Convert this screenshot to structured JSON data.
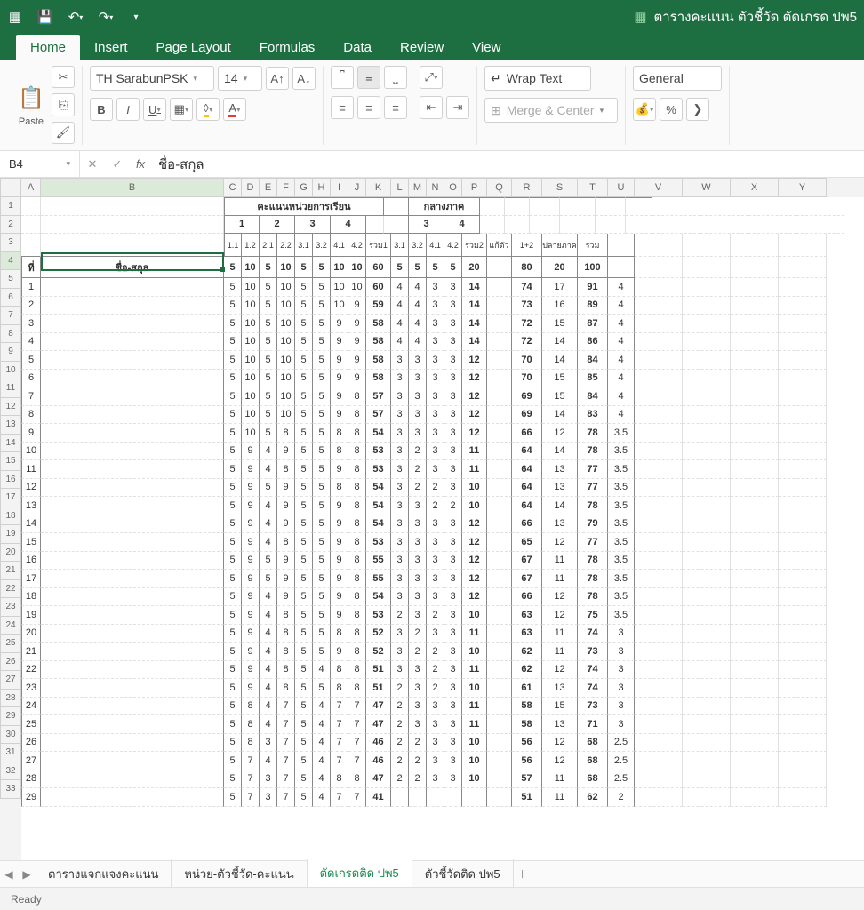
{
  "title": "ตารางคะแนน ตัวชี้วัด ตัดเกรด ปพ5",
  "tabs": [
    "Home",
    "Insert",
    "Page Layout",
    "Formulas",
    "Data",
    "Review",
    "View"
  ],
  "activeTab": "Home",
  "ribbon": {
    "paste": "Paste",
    "font": "TH SarabunPSK",
    "fontSize": "14",
    "wrap": "Wrap Text",
    "merge": "Merge & Center",
    "numberFormat": "General"
  },
  "nameBox": "B4",
  "formula": "ชื่อ-สกุล",
  "colHeaders": [
    "A",
    "B",
    "C",
    "D",
    "E",
    "F",
    "G",
    "H",
    "I",
    "J",
    "K",
    "L",
    "M",
    "N",
    "O",
    "P",
    "Q",
    "R",
    "S",
    "T",
    "U",
    "V",
    "W",
    "X",
    "Y"
  ],
  "rowCount": 33,
  "gridHeader": {
    "top1_unit": "คะแนนหน่วยการเรียน",
    "top1_mid": "กลางภาค",
    "units": [
      "1",
      "2",
      "3",
      "4"
    ],
    "midUnits": [
      "3",
      "4"
    ],
    "sub": [
      "1.1",
      "1.2",
      "2.1",
      "2.2",
      "3.1",
      "3.2",
      "4.1",
      "4.2",
      "รวม1",
      "3.1",
      "3.2",
      "4.1",
      "4.2",
      "รวม2",
      "แก้ตัว",
      "1+2",
      "ปลายภาค",
      "รวม"
    ],
    "colA4": "ที่",
    "colB4": "ชื่อ-สกุล",
    "max": [
      "5",
      "10",
      "5",
      "10",
      "5",
      "5",
      "10",
      "10",
      "60",
      "5",
      "5",
      "5",
      "5",
      "20",
      "",
      "80",
      "20",
      "100",
      ""
    ]
  },
  "rows": [
    [
      "1",
      "5",
      "10",
      "5",
      "10",
      "5",
      "5",
      "10",
      "10",
      "60",
      "4",
      "4",
      "3",
      "3",
      "14",
      "",
      "74",
      "17",
      "91",
      "4"
    ],
    [
      "2",
      "5",
      "10",
      "5",
      "10",
      "5",
      "5",
      "10",
      "9",
      "59",
      "4",
      "4",
      "3",
      "3",
      "14",
      "",
      "73",
      "16",
      "89",
      "4"
    ],
    [
      "3",
      "5",
      "10",
      "5",
      "10",
      "5",
      "5",
      "9",
      "9",
      "58",
      "4",
      "4",
      "3",
      "3",
      "14",
      "",
      "72",
      "15",
      "87",
      "4"
    ],
    [
      "4",
      "5",
      "10",
      "5",
      "10",
      "5",
      "5",
      "9",
      "9",
      "58",
      "4",
      "4",
      "3",
      "3",
      "14",
      "",
      "72",
      "14",
      "86",
      "4"
    ],
    [
      "5",
      "5",
      "10",
      "5",
      "10",
      "5",
      "5",
      "9",
      "9",
      "58",
      "3",
      "3",
      "3",
      "3",
      "12",
      "",
      "70",
      "14",
      "84",
      "4"
    ],
    [
      "6",
      "5",
      "10",
      "5",
      "10",
      "5",
      "5",
      "9",
      "9",
      "58",
      "3",
      "3",
      "3",
      "3",
      "12",
      "",
      "70",
      "15",
      "85",
      "4"
    ],
    [
      "7",
      "5",
      "10",
      "5",
      "10",
      "5",
      "5",
      "9",
      "8",
      "57",
      "3",
      "3",
      "3",
      "3",
      "12",
      "",
      "69",
      "15",
      "84",
      "4"
    ],
    [
      "8",
      "5",
      "10",
      "5",
      "10",
      "5",
      "5",
      "9",
      "8",
      "57",
      "3",
      "3",
      "3",
      "3",
      "12",
      "",
      "69",
      "14",
      "83",
      "4"
    ],
    [
      "9",
      "5",
      "10",
      "5",
      "8",
      "5",
      "5",
      "8",
      "8",
      "54",
      "3",
      "3",
      "3",
      "3",
      "12",
      "",
      "66",
      "12",
      "78",
      "3.5"
    ],
    [
      "10",
      "5",
      "9",
      "4",
      "9",
      "5",
      "5",
      "8",
      "8",
      "53",
      "3",
      "2",
      "3",
      "3",
      "11",
      "",
      "64",
      "14",
      "78",
      "3.5"
    ],
    [
      "11",
      "5",
      "9",
      "4",
      "8",
      "5",
      "5",
      "9",
      "8",
      "53",
      "3",
      "2",
      "3",
      "3",
      "11",
      "",
      "64",
      "13",
      "77",
      "3.5"
    ],
    [
      "12",
      "5",
      "9",
      "5",
      "9",
      "5",
      "5",
      "8",
      "8",
      "54",
      "3",
      "2",
      "2",
      "3",
      "10",
      "",
      "64",
      "13",
      "77",
      "3.5"
    ],
    [
      "13",
      "5",
      "9",
      "4",
      "9",
      "5",
      "5",
      "9",
      "8",
      "54",
      "3",
      "3",
      "2",
      "2",
      "10",
      "",
      "64",
      "14",
      "78",
      "3.5"
    ],
    [
      "14",
      "5",
      "9",
      "4",
      "9",
      "5",
      "5",
      "9",
      "8",
      "54",
      "3",
      "3",
      "3",
      "3",
      "12",
      "",
      "66",
      "13",
      "79",
      "3.5"
    ],
    [
      "15",
      "5",
      "9",
      "4",
      "8",
      "5",
      "5",
      "9",
      "8",
      "53",
      "3",
      "3",
      "3",
      "3",
      "12",
      "",
      "65",
      "12",
      "77",
      "3.5"
    ],
    [
      "16",
      "5",
      "9",
      "5",
      "9",
      "5",
      "5",
      "9",
      "8",
      "55",
      "3",
      "3",
      "3",
      "3",
      "12",
      "",
      "67",
      "11",
      "78",
      "3.5"
    ],
    [
      "17",
      "5",
      "9",
      "5",
      "9",
      "5",
      "5",
      "9",
      "8",
      "55",
      "3",
      "3",
      "3",
      "3",
      "12",
      "",
      "67",
      "11",
      "78",
      "3.5"
    ],
    [
      "18",
      "5",
      "9",
      "4",
      "9",
      "5",
      "5",
      "9",
      "8",
      "54",
      "3",
      "3",
      "3",
      "3",
      "12",
      "",
      "66",
      "12",
      "78",
      "3.5"
    ],
    [
      "19",
      "5",
      "9",
      "4",
      "8",
      "5",
      "5",
      "9",
      "8",
      "53",
      "2",
      "3",
      "2",
      "3",
      "10",
      "",
      "63",
      "12",
      "75",
      "3.5"
    ],
    [
      "20",
      "5",
      "9",
      "4",
      "8",
      "5",
      "5",
      "8",
      "8",
      "52",
      "3",
      "2",
      "3",
      "3",
      "11",
      "",
      "63",
      "11",
      "74",
      "3"
    ],
    [
      "21",
      "5",
      "9",
      "4",
      "8",
      "5",
      "5",
      "9",
      "8",
      "52",
      "3",
      "2",
      "2",
      "3",
      "10",
      "",
      "62",
      "11",
      "73",
      "3"
    ],
    [
      "22",
      "5",
      "9",
      "4",
      "8",
      "5",
      "4",
      "8",
      "8",
      "51",
      "3",
      "3",
      "2",
      "3",
      "11",
      "",
      "62",
      "12",
      "74",
      "3"
    ],
    [
      "23",
      "5",
      "9",
      "4",
      "8",
      "5",
      "5",
      "8",
      "8",
      "51",
      "2",
      "3",
      "2",
      "3",
      "10",
      "",
      "61",
      "13",
      "74",
      "3"
    ],
    [
      "24",
      "5",
      "8",
      "4",
      "7",
      "5",
      "4",
      "7",
      "7",
      "47",
      "2",
      "3",
      "3",
      "3",
      "11",
      "",
      "58",
      "15",
      "73",
      "3"
    ],
    [
      "25",
      "5",
      "8",
      "4",
      "7",
      "5",
      "4",
      "7",
      "7",
      "47",
      "2",
      "3",
      "3",
      "3",
      "11",
      "",
      "58",
      "13",
      "71",
      "3"
    ],
    [
      "26",
      "5",
      "8",
      "3",
      "7",
      "5",
      "4",
      "7",
      "7",
      "46",
      "2",
      "2",
      "3",
      "3",
      "10",
      "",
      "56",
      "12",
      "68",
      "2.5"
    ],
    [
      "27",
      "5",
      "7",
      "4",
      "7",
      "5",
      "4",
      "7",
      "7",
      "46",
      "2",
      "2",
      "3",
      "3",
      "10",
      "",
      "56",
      "12",
      "68",
      "2.5"
    ],
    [
      "28",
      "5",
      "7",
      "3",
      "7",
      "5",
      "4",
      "8",
      "8",
      "47",
      "2",
      "2",
      "3",
      "3",
      "10",
      "",
      "57",
      "11",
      "68",
      "2.5"
    ],
    [
      "29",
      "5",
      "7",
      "3",
      "7",
      "5",
      "4",
      "7",
      "7",
      "41",
      "",
      "",
      "",
      "",
      "",
      "",
      "51",
      "11",
      "62",
      "2"
    ]
  ],
  "sheetTabs": [
    "ตารางแจกแจงคะแนน",
    "หน่วย-ตัวชี้วัด-คะแนน",
    "ตัดเกรดติด ปพ5",
    "ตัวชี้วัดติด ปพ5"
  ],
  "activeSheet": "ตัดเกรดติด ปพ5",
  "status": "Ready"
}
